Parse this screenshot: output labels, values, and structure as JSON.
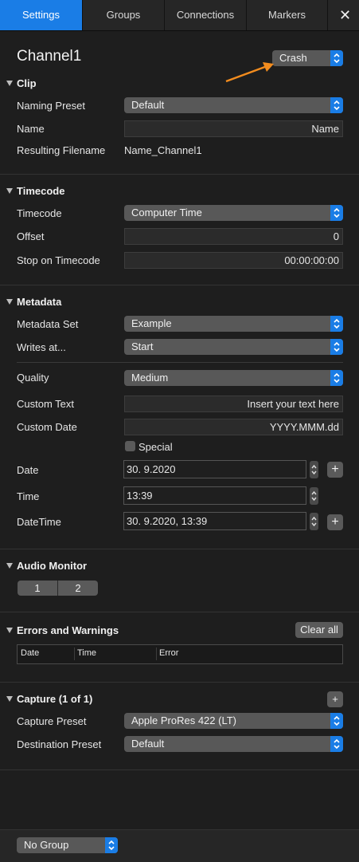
{
  "tabs": [
    {
      "label": "Settings",
      "active": true
    },
    {
      "label": "Groups",
      "active": false
    },
    {
      "label": "Connections",
      "active": false
    },
    {
      "label": "Markers",
      "active": false
    }
  ],
  "close_label": "✕",
  "channel_title": "Channel1",
  "crash_popup": "Crash",
  "clip": {
    "header": "Clip",
    "naming_preset_label": "Naming Preset",
    "naming_preset_value": "Default",
    "name_label": "Name",
    "name_value": "Name",
    "resulting_filename_label": "Resulting Filename",
    "resulting_filename_value": "Name_Channel1"
  },
  "timecode": {
    "header": "Timecode",
    "timecode_label": "Timecode",
    "timecode_value": "Computer Time",
    "offset_label": "Offset",
    "offset_value": "0",
    "stop_label": "Stop on Timecode",
    "stop_value": "00:00:00:00"
  },
  "metadata": {
    "header": "Metadata",
    "set_label": "Metadata Set",
    "set_value": "Example",
    "writes_label": "Writes at...",
    "writes_value": "Start",
    "quality_label": "Quality",
    "quality_value": "Medium",
    "custom_text_label": "Custom Text",
    "custom_text_value": "Insert your text here",
    "custom_date_label": "Custom Date",
    "custom_date_value": "YYYY.MMM.dd",
    "special_label": "Special",
    "date_label": "Date",
    "date_value": "30.  9.2020",
    "time_label": "Time",
    "time_value": "13:39",
    "datetime_label": "DateTime",
    "datetime_value": "30.  9.2020,  13:39"
  },
  "audio": {
    "header": "Audio Monitor",
    "segments": [
      "1",
      "2"
    ]
  },
  "errors": {
    "header": "Errors and Warnings",
    "clear_label": "Clear all",
    "columns": [
      "Date",
      "Time",
      "Error"
    ]
  },
  "capture": {
    "header": "Capture (1 of 1)",
    "preset_label": "Capture Preset",
    "preset_value": "Apple ProRes 422 (LT)",
    "dest_label": "Destination Preset",
    "dest_value": "Default"
  },
  "footer": {
    "group_value": "No Group"
  },
  "colors": {
    "accent": "#1a7de6",
    "annotation_arrow": "#f28c1e"
  }
}
